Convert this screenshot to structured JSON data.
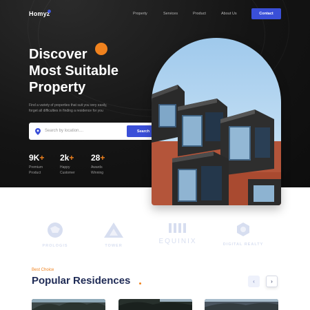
{
  "header": {
    "logo": "Homyz",
    "nav": [
      "Property",
      "Services",
      "Product",
      "About Us"
    ],
    "contact_label": "Contact"
  },
  "hero": {
    "title_lines": [
      "Discover",
      "Most Suitable",
      "Property"
    ],
    "subtitle_lines": [
      "Find a variety of properties that suit you very easily,",
      "forget all difficulties in finding a residence for you"
    ],
    "search": {
      "placeholder": "Search by location....",
      "button_label": "Search"
    },
    "stats": [
      {
        "value": "9K",
        "plus": "+",
        "label_lines": [
          "Premium",
          "Product"
        ]
      },
      {
        "value": "2k",
        "plus": "+",
        "label_lines": [
          "Happy",
          "Customer"
        ]
      },
      {
        "value": "28",
        "plus": "+",
        "label_lines": [
          "Awards",
          "Winning"
        ]
      }
    ]
  },
  "partners": [
    "PROLOGIS",
    "TOWER",
    "EQUINIX",
    "DIGITAL REALTY"
  ],
  "residences": {
    "eyebrow": "Best Choice",
    "title": "Popular Residences",
    "prev_icon": "chevron-left-icon",
    "next_icon": "chevron-right-icon"
  },
  "colors": {
    "accent_blue": "#3a4fd8",
    "accent_orange": "#f0821e",
    "hero_bg": "#141414",
    "heading_navy": "#1e2a55"
  }
}
